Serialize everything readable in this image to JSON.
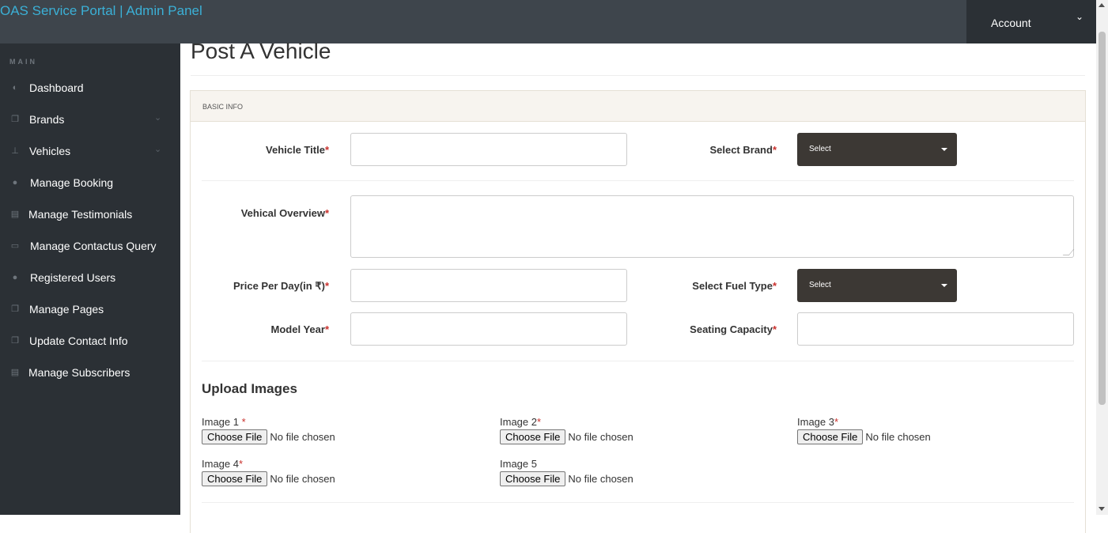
{
  "header": {
    "title": "OAS Service Portal | Admin Panel",
    "account_label": "Account",
    "account_chevron": "chevron-down-icon"
  },
  "sidebar": {
    "heading": "MAIN",
    "items": [
      {
        "label": "Dashboard",
        "icon": "dashboard-icon"
      },
      {
        "label": "Brands",
        "icon": "files-icon",
        "has_caret": true
      },
      {
        "label": "Vehicles",
        "icon": "sitemap-icon",
        "has_caret": true
      },
      {
        "label": "Manage Booking",
        "icon": "users-icon"
      },
      {
        "label": "Manage Testimonials",
        "icon": "table-icon"
      },
      {
        "label": "Manage Contactus Query",
        "icon": "desktop-icon"
      },
      {
        "label": "Registered Users",
        "icon": "users-icon"
      },
      {
        "label": "Manage Pages",
        "icon": "files-icon"
      },
      {
        "label": "Update Contact Info",
        "icon": "files-icon"
      },
      {
        "label": "Manage Subscribers",
        "icon": "table-icon"
      }
    ]
  },
  "page": {
    "title": "Post A Vehicle"
  },
  "form": {
    "panel_heading": "BASIC INFO",
    "vehicle_title_label": "Vehicle Title",
    "select_brand_label": "Select Brand",
    "brand_select_value": "Select",
    "overview_label": "Vehical Overview",
    "price_label": "Price Per Day(in ₹)",
    "fuel_label": "Select Fuel Type",
    "fuel_select_value": "Select",
    "model_year_label": "Model Year",
    "seating_label": "Seating Capacity",
    "required_mark": "*"
  },
  "upload": {
    "heading": "Upload Images",
    "button_label": "Choose File",
    "no_file_text": "No file chosen",
    "images": [
      {
        "label": "Image 1 ",
        "required": true
      },
      {
        "label": "Image 2",
        "required": true
      },
      {
        "label": "Image 3",
        "required": true
      },
      {
        "label": "Image 4",
        "required": true
      },
      {
        "label": "Image 5",
        "required": false
      }
    ]
  },
  "colors": {
    "topbar": "#3e454c",
    "sidebar": "#2b3035",
    "brand_text": "#3bb0d6",
    "select_bg": "#3c3834",
    "required": "#c9302c"
  }
}
